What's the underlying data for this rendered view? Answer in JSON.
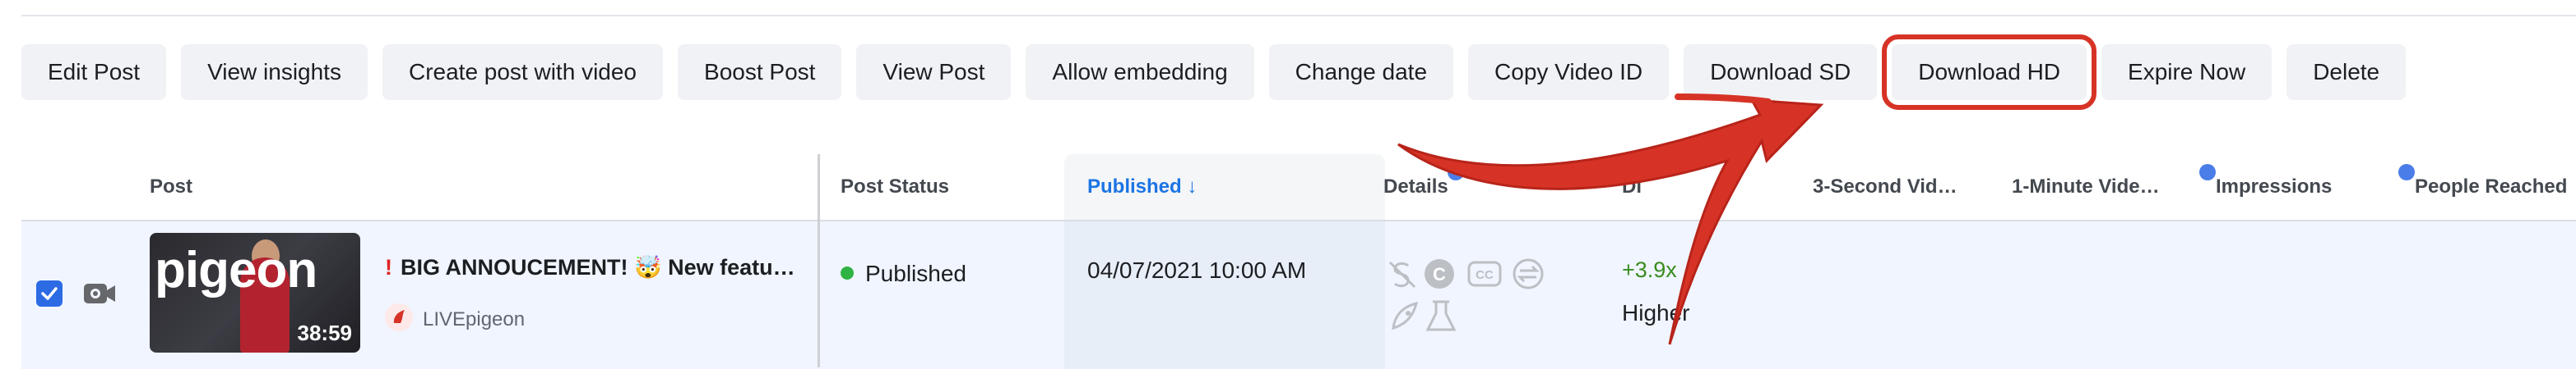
{
  "toolbar": {
    "buttons": [
      "Edit Post",
      "View insights",
      "Create post with video",
      "Boost Post",
      "View Post",
      "Allow embedding",
      "Change date",
      "Copy Video ID",
      "Download SD",
      "Download HD",
      "Expire Now",
      "Delete"
    ],
    "highlighted": "Download HD"
  },
  "table": {
    "headers": {
      "post": "Post",
      "post_status": "Post Status",
      "published": "Published ↓",
      "details": "Details",
      "distribution": "Di",
      "three_sec": "3-Second Vid…",
      "one_min": "1-Minute Vide…",
      "impressions": "Impressions",
      "people_reached": "People Reached"
    },
    "row": {
      "selected": true,
      "thumbnail_brand": "pigeon",
      "duration": "38:59",
      "title_mark": "!",
      "title": "BIG ANNOUCEMENT! 🤯 New featu…",
      "page_name": "LIVEpigeon",
      "status": "Published",
      "published_date": "04/07/2021 10:00 AM",
      "performance": "+3.9x",
      "performance_label": "Higher"
    }
  },
  "colors": {
    "accent": "#1b74e4",
    "annotation_red": "#d63326",
    "status_green": "#2fb344"
  }
}
